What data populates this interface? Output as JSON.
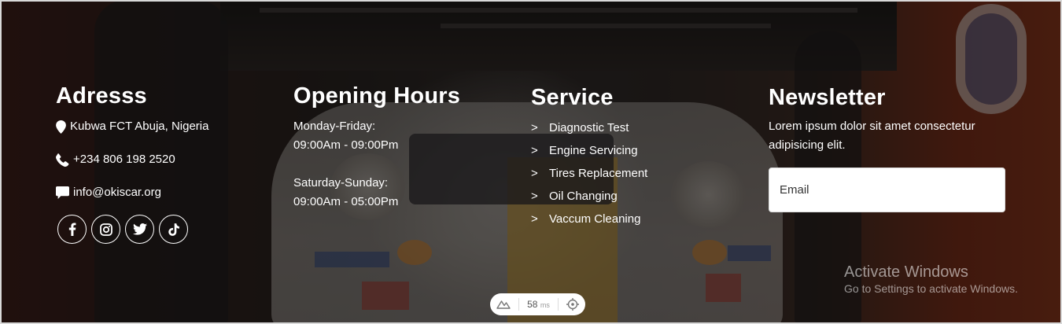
{
  "address": {
    "title": "Adresss",
    "location": "Kubwa FCT Abuja, Nigeria",
    "phone": "+234 806 198 2520",
    "email": "info@okiscar.org",
    "socials": [
      "facebook-icon",
      "instagram-icon",
      "twitter-icon",
      "tiktok-icon"
    ]
  },
  "hours": {
    "title": "Opening Hours",
    "weekday_label": "Monday-Friday:",
    "weekday_time": "09:00Am - 09:00Pm",
    "weekend_label": "Saturday-Sunday:",
    "weekend_time": "09:00Am - 05:00Pm"
  },
  "service": {
    "title": "Service",
    "arrow": ">",
    "items": [
      "Diagnostic Test",
      "Engine Servicing",
      "Tires Replacement",
      "Oil Changing",
      "Vaccum Cleaning"
    ]
  },
  "newsletter": {
    "title": "Newsletter",
    "text": "Lorem ipsum dolor sit amet consectetur adipisicing elit.",
    "email_placeholder": "Email"
  },
  "watermark": {
    "line1": "Activate Windows",
    "line2": "Go to Settings to activate Windows."
  },
  "perf": {
    "value": "58",
    "unit": "ms"
  }
}
